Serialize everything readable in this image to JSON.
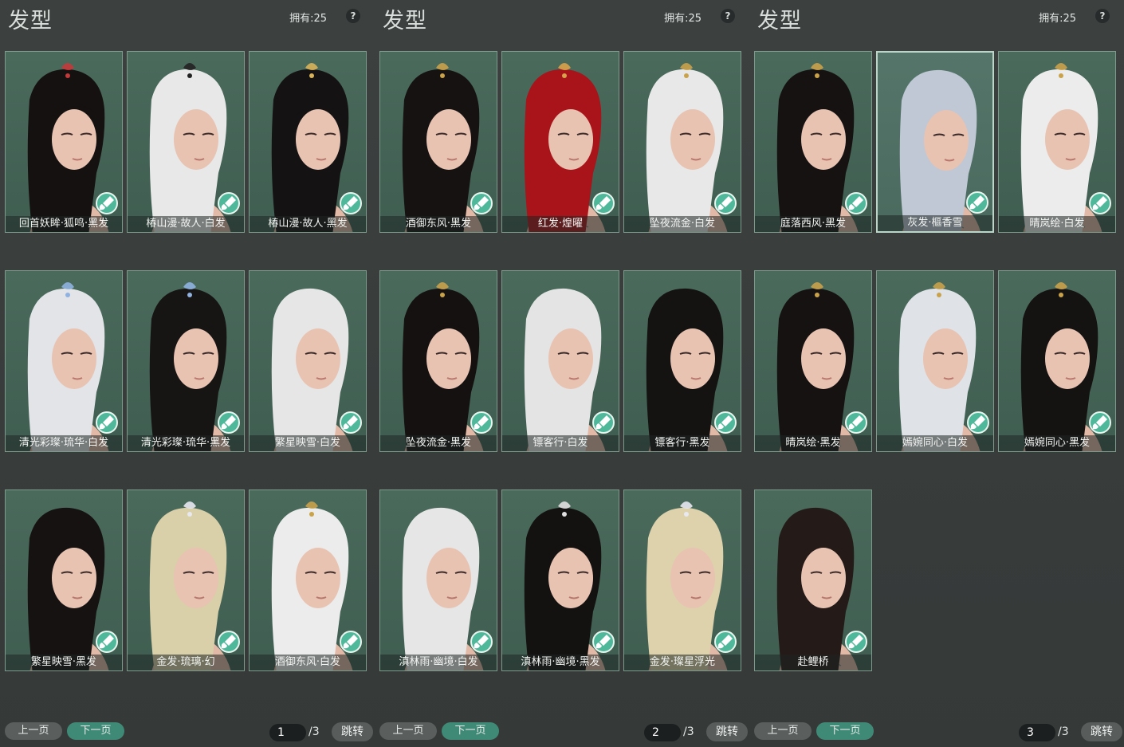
{
  "panels": [
    {
      "title": "发型",
      "owned": "拥有:25",
      "help": "?",
      "prev": "上一页",
      "next": "下一页",
      "page": "1",
      "total": "/3",
      "jump": "跳转",
      "items": [
        {
          "label": "回首妖眸·狐鸣·黑发",
          "hair": "#151111",
          "acc": "#c43a3a"
        },
        {
          "label": "椿山漫·故人·白发",
          "hair": "#e8e8e8",
          "acc": "#222222"
        },
        {
          "label": "椿山漫·故人·黑发",
          "hair": "#141212",
          "acc": "#d8b35a"
        },
        {
          "label": "清光彩璨·琉华·白发",
          "hair": "#e2e4e8",
          "acc": "#8fb2e0"
        },
        {
          "label": "清光彩璨·琉华·黑发",
          "hair": "#171414",
          "acc": "#8fb2e0"
        },
        {
          "label": "繁星映雪·白发",
          "hair": "#e6e6e6",
          "acc": ""
        },
        {
          "label": "繁星映雪·黑发",
          "hair": "#161212",
          "acc": ""
        },
        {
          "label": "金发·琉璃·幻",
          "hair": "#d9cfa8",
          "acc": "#e8e8f0"
        },
        {
          "label": "酒御东风·白发",
          "hair": "#ececec",
          "acc": "#c9a24a"
        }
      ]
    },
    {
      "title": "发型",
      "owned": "拥有:25",
      "help": "?",
      "prev": "上一页",
      "next": "下一页",
      "page": "2",
      "total": "/3",
      "jump": "跳转",
      "items": [
        {
          "label": "酒御东风·黑发",
          "hair": "#161212",
          "acc": "#c9a24a"
        },
        {
          "label": "红发·煌曜",
          "hair": "#a8141a",
          "acc": "#d8a24a"
        },
        {
          "label": "坠夜流金·白发",
          "hair": "#e8e8e8",
          "acc": "#c9a24a"
        },
        {
          "label": "坠夜流金·黑发",
          "hair": "#151111",
          "acc": "#c9a24a"
        },
        {
          "label": "镖客行·白发",
          "hair": "#e4e4e4",
          "acc": ""
        },
        {
          "label": "镖客行·黑发",
          "hair": "#151212",
          "acc": ""
        },
        {
          "label": "滇林雨·幽境·白发",
          "hair": "#e6e6e6",
          "acc": ""
        },
        {
          "label": "滇林雨·幽境·黑发",
          "hair": "#141111",
          "acc": "#e0e0e0"
        },
        {
          "label": "金发·璨星浮光",
          "hair": "#ddd2ac",
          "acc": "#e8e8f0"
        }
      ]
    },
    {
      "title": "发型",
      "owned": "拥有:25",
      "help": "?",
      "prev": "上一页",
      "next": "下一页",
      "page": "3",
      "total": "/3",
      "jump": "跳转",
      "items": [
        {
          "label": "庭落西风·黑发",
          "hair": "#161212",
          "acc": "#c9a24a"
        },
        {
          "label": "灰发·樞香雪",
          "hair": "#bfc8d4",
          "acc": "",
          "selected": true
        },
        {
          "label": "晴岚绘·白发",
          "hair": "#ececec",
          "acc": "#c9a24a"
        },
        {
          "label": "晴岚绘·黑发",
          "hair": "#161212",
          "acc": "#c9a24a"
        },
        {
          "label": "嫣婉同心·白发",
          "hair": "#dfe2e6",
          "acc": "#c9a24a"
        },
        {
          "label": "嫣婉同心·黑发",
          "hair": "#151212",
          "acc": "#c9a24a"
        },
        {
          "label": "赴鲤桥",
          "hair": "#241a18",
          "acc": ""
        }
      ]
    }
  ]
}
